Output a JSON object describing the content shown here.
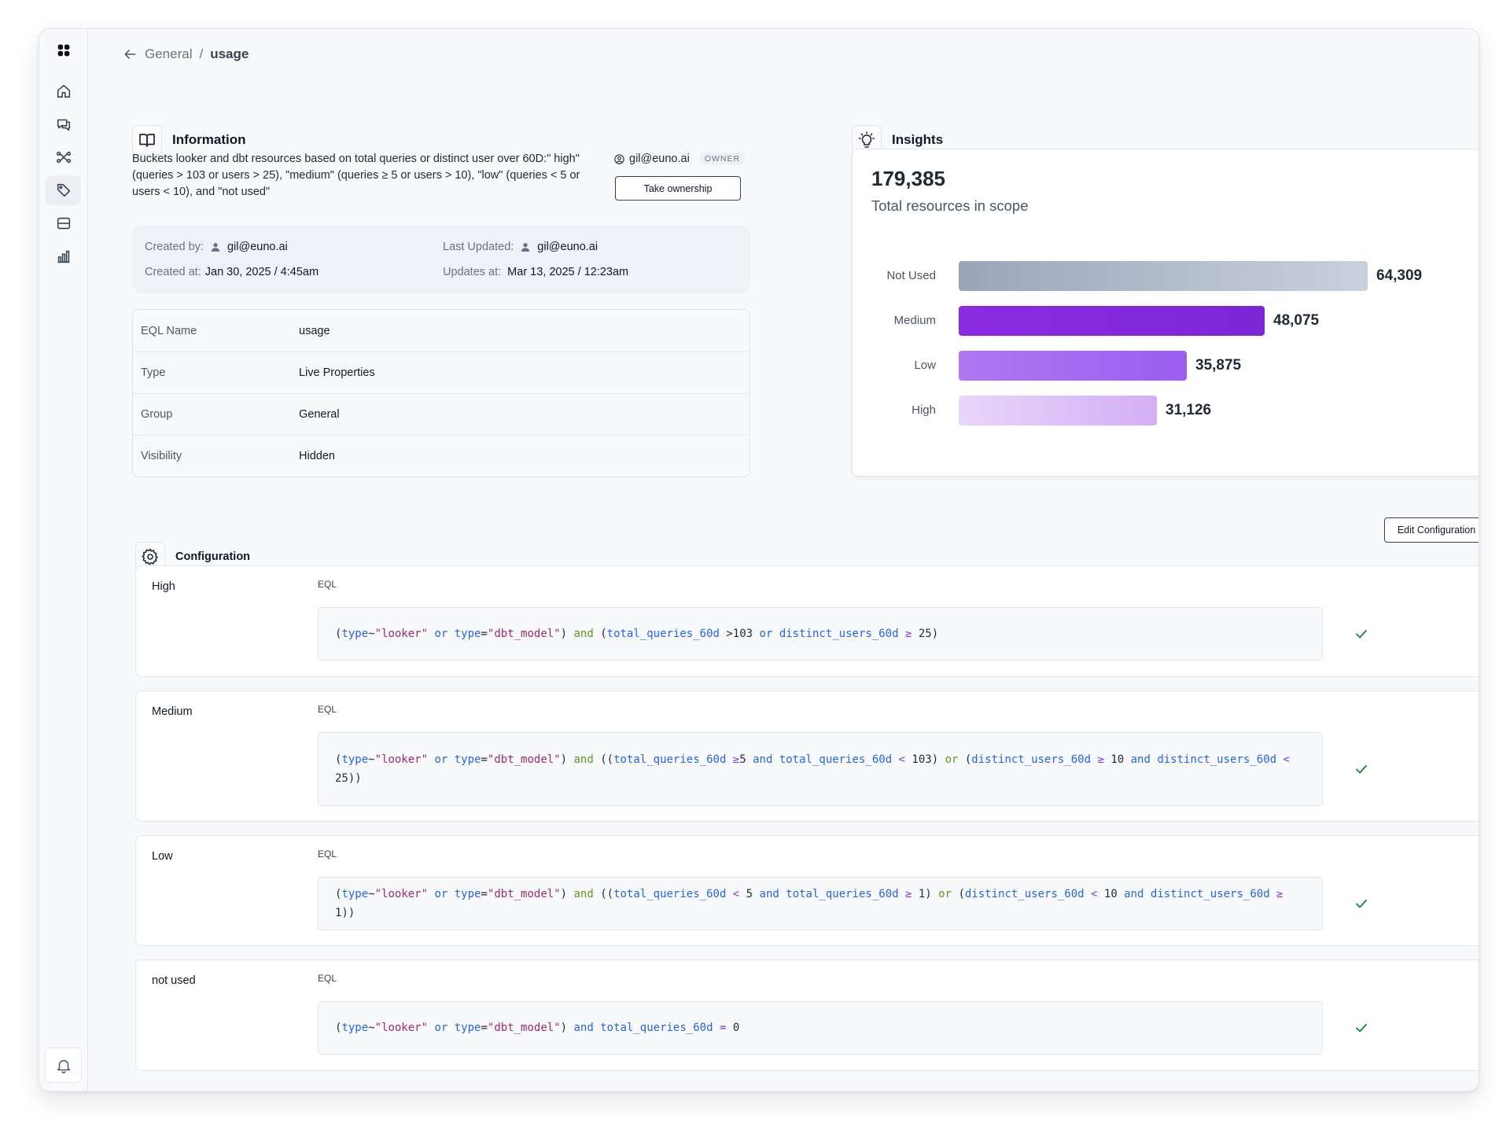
{
  "breadcrumb": {
    "parent": "General",
    "separator": "/",
    "current": "usage"
  },
  "information": {
    "title": "Information",
    "description": "Buckets looker and dbt resources based on total queries or distinct user over 60D:\" high\" (queries > 103 or users > 25), \"medium\" (queries ≥ 5 or users > 10), \"low\" (queries < 5 or users < 10), and \"not used\"",
    "owner": {
      "email": "gil@euno.ai",
      "badge": "OWNER",
      "take_ownership_label": "Take ownership"
    },
    "meta": {
      "created_by_label": "Created by:",
      "created_by": "gil@euno.ai",
      "created_at_label": "Created at:",
      "created_at": "Jan 30, 2025 / 4:45am",
      "last_updated_label": "Last Updated:",
      "last_updated": "gil@euno.ai",
      "updates_at_label": "Updates at:",
      "updates_at": "Mar 13, 2025 / 12:23am"
    },
    "properties": [
      {
        "key": "EQL Name",
        "value": "usage"
      },
      {
        "key": "Type",
        "value": "Live Properties"
      },
      {
        "key": "Group",
        "value": "General"
      },
      {
        "key": "Visibility",
        "value": "Hidden"
      }
    ]
  },
  "insights": {
    "title": "Insights",
    "total": "179,385",
    "total_label": "Total resources in scope"
  },
  "chart_data": {
    "type": "bar",
    "orientation": "horizontal",
    "categories": [
      "Not Used",
      "Medium",
      "Low",
      "High"
    ],
    "values": [
      64309,
      48075,
      35875,
      31126
    ],
    "value_labels": [
      "64,309",
      "48,075",
      "35,875",
      "31,126"
    ],
    "colors": [
      [
        "#9aa6b8",
        "#c8d1dd"
      ],
      [
        "#8a2be2",
        "#7c26d6"
      ],
      [
        "#b077f0",
        "#9b5ef0"
      ],
      [
        "#e9d6fb",
        "#d3aef5"
      ]
    ],
    "title": "",
    "xlabel": "",
    "ylabel": ""
  },
  "configuration": {
    "title": "Configuration",
    "edit_label": "Edit Configuration",
    "eql_label": "EQL",
    "items": [
      {
        "name": "High",
        "code": [
          [
            "(",
            "punc"
          ],
          [
            "type",
            "field"
          ],
          [
            "~",
            "punc"
          ],
          [
            "\"looker\"",
            "str"
          ],
          [
            " or ",
            "or"
          ],
          [
            "type",
            "field"
          ],
          [
            "=",
            "punc"
          ],
          [
            "\"dbt_model\"",
            "str"
          ],
          [
            ") ",
            "punc"
          ],
          [
            "and",
            "and-g"
          ],
          [
            " (",
            "punc"
          ],
          [
            "total_queries_60d",
            "field"
          ],
          [
            " >",
            "punc"
          ],
          [
            "103",
            "num"
          ],
          [
            " or ",
            "or"
          ],
          [
            "distinct_users_60d",
            "field"
          ],
          [
            " ≥ ",
            "op"
          ],
          [
            "25",
            "num"
          ],
          [
            ")",
            "punc"
          ]
        ]
      },
      {
        "name": "Medium",
        "code": [
          [
            "(",
            "punc"
          ],
          [
            "type",
            "field"
          ],
          [
            "~",
            "punc"
          ],
          [
            "\"looker\"",
            "str"
          ],
          [
            " or ",
            "or"
          ],
          [
            "type",
            "field"
          ],
          [
            "=",
            "punc"
          ],
          [
            "\"dbt_model\"",
            "str"
          ],
          [
            ") ",
            "punc"
          ],
          [
            "and",
            "and-g"
          ],
          [
            " ((",
            "punc"
          ],
          [
            "total_queries_60d",
            "field"
          ],
          [
            " ≥",
            "op"
          ],
          [
            "5",
            "num"
          ],
          [
            " and ",
            "and-b"
          ],
          [
            "total_queries_60d",
            "field"
          ],
          [
            " < ",
            "op"
          ],
          [
            "103",
            "num"
          ],
          [
            ") ",
            "punc"
          ],
          [
            "or",
            "and-g"
          ],
          [
            " (",
            "punc"
          ],
          [
            "distinct_users_60d",
            "field"
          ],
          [
            " ≥ ",
            "op"
          ],
          [
            "10",
            "num"
          ],
          [
            " and ",
            "and-b"
          ],
          [
            "distinct_users_60d",
            "field"
          ],
          [
            " < ",
            "op"
          ],
          [
            "25",
            "num"
          ],
          [
            "))",
            "punc"
          ]
        ]
      },
      {
        "name": "Low",
        "code": [
          [
            "(",
            "punc"
          ],
          [
            "type",
            "field"
          ],
          [
            "~",
            "punc"
          ],
          [
            "\"looker\"",
            "str"
          ],
          [
            " or ",
            "or"
          ],
          [
            "type",
            "field"
          ],
          [
            "=",
            "punc"
          ],
          [
            "\"dbt_model\"",
            "str"
          ],
          [
            ") ",
            "punc"
          ],
          [
            "and",
            "and-g"
          ],
          [
            " ((",
            "punc"
          ],
          [
            "total_queries_60d",
            "field"
          ],
          [
            " < ",
            "op"
          ],
          [
            "5",
            "num"
          ],
          [
            " and ",
            "and-b"
          ],
          [
            "total_queries_60d",
            "field"
          ],
          [
            " ≥ ",
            "op"
          ],
          [
            "1",
            "num"
          ],
          [
            ") ",
            "punc"
          ],
          [
            "or",
            "and-g"
          ],
          [
            " (",
            "punc"
          ],
          [
            "distinct_users_60d",
            "field"
          ],
          [
            " < ",
            "op"
          ],
          [
            "10",
            "num"
          ],
          [
            " and ",
            "and-b"
          ],
          [
            "distinct_users_60d",
            "field"
          ],
          [
            " ≥ ",
            "op"
          ],
          [
            "1",
            "num"
          ],
          [
            "))",
            "punc"
          ]
        ]
      },
      {
        "name": "not used",
        "code": [
          [
            "(",
            "punc"
          ],
          [
            "type",
            "field"
          ],
          [
            "~",
            "punc"
          ],
          [
            "\"looker\"",
            "str"
          ],
          [
            " or ",
            "or"
          ],
          [
            "type",
            "field"
          ],
          [
            "=",
            "punc"
          ],
          [
            "\"dbt_model\"",
            "str"
          ],
          [
            ") ",
            "punc"
          ],
          [
            "and",
            "and-b"
          ],
          [
            " ",
            "punc"
          ],
          [
            "total_queries_60d",
            "field"
          ],
          [
            " = ",
            "op"
          ],
          [
            "0",
            "num"
          ]
        ]
      }
    ]
  },
  "colors": {
    "accent_purple": "#8a2be2",
    "check_green": "#15803d",
    "field_blue": "#2563eb",
    "string_magenta": "#9d2a6f"
  }
}
